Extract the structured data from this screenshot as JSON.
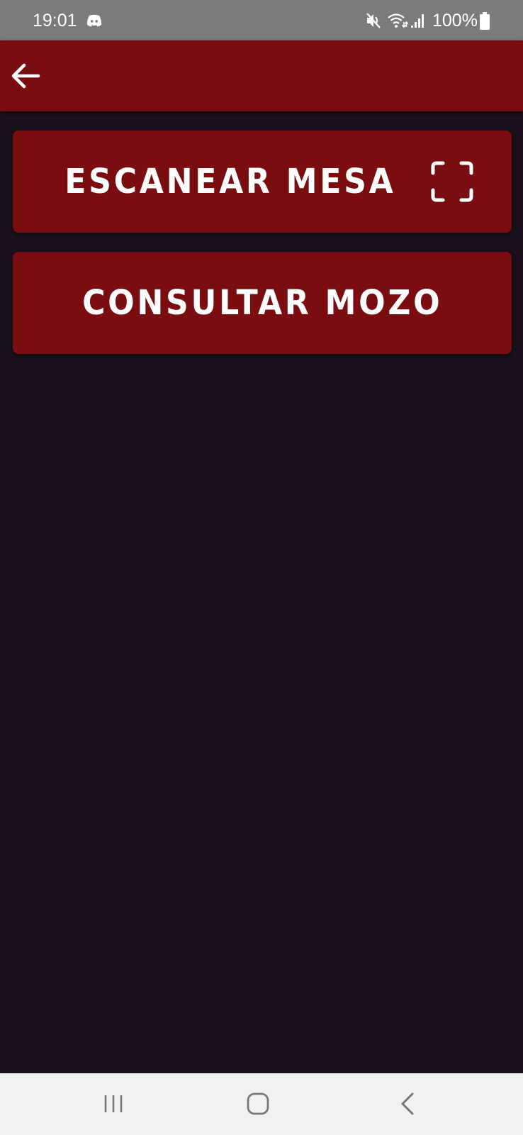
{
  "status_bar": {
    "time": "19:01",
    "battery": "100%",
    "icons": [
      "discord-icon",
      "mute-icon",
      "wifi-icon",
      "signal-icon",
      "battery-icon"
    ]
  },
  "app_bar": {
    "back_icon": "arrow-left-icon"
  },
  "buttons": {
    "scan": {
      "label": "ESCANEAR MESA",
      "icon": "qr-scan-frame-icon"
    },
    "waiter": {
      "label": "CONSULTAR MOZO"
    }
  },
  "nav_bar": {
    "icons": [
      "recent-apps-icon",
      "home-icon",
      "back-icon"
    ]
  },
  "colors": {
    "primary": "#790d10",
    "background": "#19101b",
    "status_bar": "#7b7b7b",
    "nav_bar": "#f1f1f1",
    "text": "#ffffff"
  }
}
